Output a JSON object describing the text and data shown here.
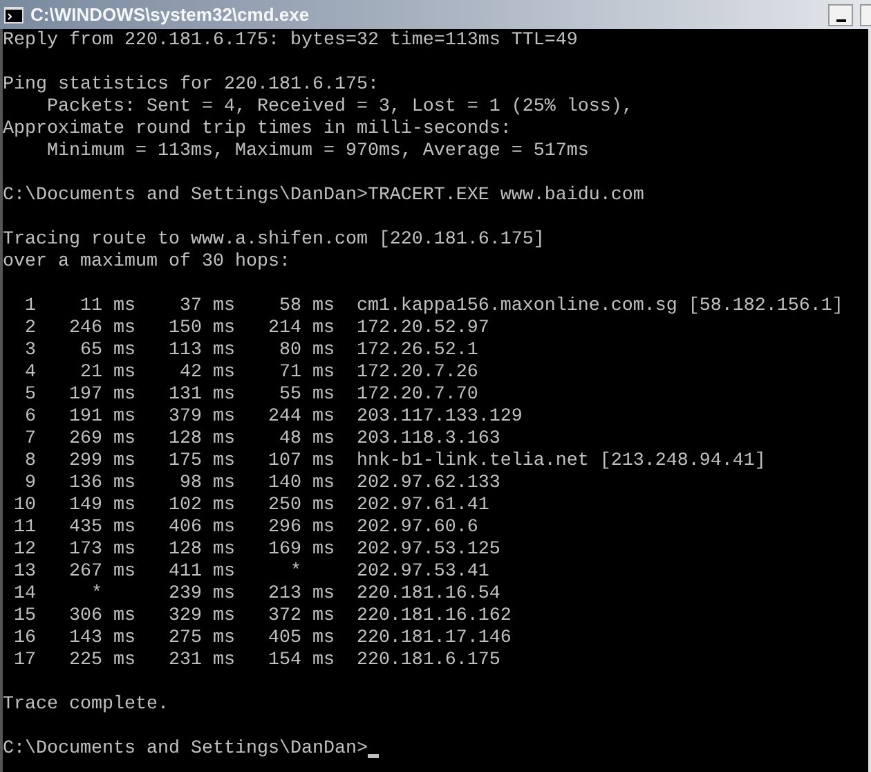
{
  "window": {
    "title": "C:\\WINDOWS\\system32\\cmd.exe"
  },
  "console": {
    "lines": [
      {
        "kind": "text",
        "text": "Reply from 220.181.6.175: bytes=32 time=113ms TTL=49"
      },
      {
        "kind": "blank"
      },
      {
        "kind": "text",
        "text": "Ping statistics for 220.181.6.175:"
      },
      {
        "kind": "text",
        "text": "    Packets: Sent = 4, Received = 3, Lost = 1 (25% loss),"
      },
      {
        "kind": "text",
        "text": "Approximate round trip times in milli-seconds:"
      },
      {
        "kind": "text",
        "text": "    Minimum = 113ms, Maximum = 970ms, Average = 517ms"
      },
      {
        "kind": "blank"
      },
      {
        "kind": "text",
        "text": "C:\\Documents and Settings\\DanDan>TRACERT.EXE www.baidu.com"
      },
      {
        "kind": "blank"
      },
      {
        "kind": "text",
        "text": "Tracing route to www.a.shifen.com [220.181.6.175]"
      },
      {
        "kind": "text",
        "text": "over a maximum of 30 hops:"
      },
      {
        "kind": "blank"
      },
      {
        "kind": "text",
        "text": "  1    11 ms    37 ms    58 ms  cm1.kappa156.maxonline.com.sg [58.182.156.1]"
      },
      {
        "kind": "text",
        "text": "  2   246 ms   150 ms   214 ms  172.20.52.97"
      },
      {
        "kind": "text",
        "text": "  3    65 ms   113 ms    80 ms  172.26.52.1"
      },
      {
        "kind": "text",
        "text": "  4    21 ms    42 ms    71 ms  172.20.7.26"
      },
      {
        "kind": "text",
        "text": "  5   197 ms   131 ms    55 ms  172.20.7.70"
      },
      {
        "kind": "text",
        "text": "  6   191 ms   379 ms   244 ms  203.117.133.129"
      },
      {
        "kind": "text",
        "text": "  7   269 ms   128 ms    48 ms  203.118.3.163"
      },
      {
        "kind": "text",
        "text": "  8   299 ms   175 ms   107 ms  hnk-b1-link.telia.net [213.248.94.41]"
      },
      {
        "kind": "text",
        "text": "  9   136 ms    98 ms   140 ms  202.97.62.133"
      },
      {
        "kind": "text",
        "text": " 10   149 ms   102 ms   250 ms  202.97.61.41"
      },
      {
        "kind": "text",
        "text": " 11   435 ms   406 ms   296 ms  202.97.60.6"
      },
      {
        "kind": "text",
        "text": " 12   173 ms   128 ms   169 ms  202.97.53.125"
      },
      {
        "kind": "text",
        "text": " 13   267 ms   411 ms     *     202.97.53.41"
      },
      {
        "kind": "text",
        "text": " 14     *      239 ms   213 ms  220.181.16.54"
      },
      {
        "kind": "text",
        "text": " 15   306 ms   329 ms   372 ms  220.181.16.162"
      },
      {
        "kind": "text",
        "text": " 16   143 ms   275 ms   405 ms  220.181.17.146"
      },
      {
        "kind": "text",
        "text": " 17   225 ms   231 ms   154 ms  220.181.6.175"
      },
      {
        "kind": "blank"
      },
      {
        "kind": "text",
        "text": "Trace complete."
      },
      {
        "kind": "blank"
      },
      {
        "kind": "prompt",
        "text": "C:\\Documents and Settings\\DanDan>",
        "cursor": true
      }
    ]
  }
}
